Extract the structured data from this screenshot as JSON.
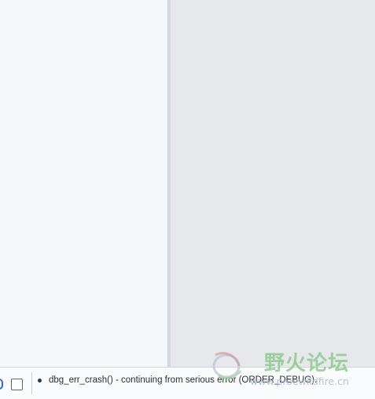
{
  "statusbar": {
    "message": "dbg_err_crash() - continuing from serious error (ORDER_DEBUG).",
    "icons": {
      "left_partial": "pencil-icon",
      "square": "stop-square-icon",
      "bullet": "bullet-icon"
    }
  },
  "watermark": {
    "title": "野火论坛",
    "url": "www.proewildfire.cn"
  },
  "colors": {
    "left_pane": "#f5f8fa",
    "right_pane": "#e6e8ec",
    "splitter": "#d4dadf",
    "statusbar": "#fafbfc",
    "watermark_green": "#8fca8f"
  }
}
